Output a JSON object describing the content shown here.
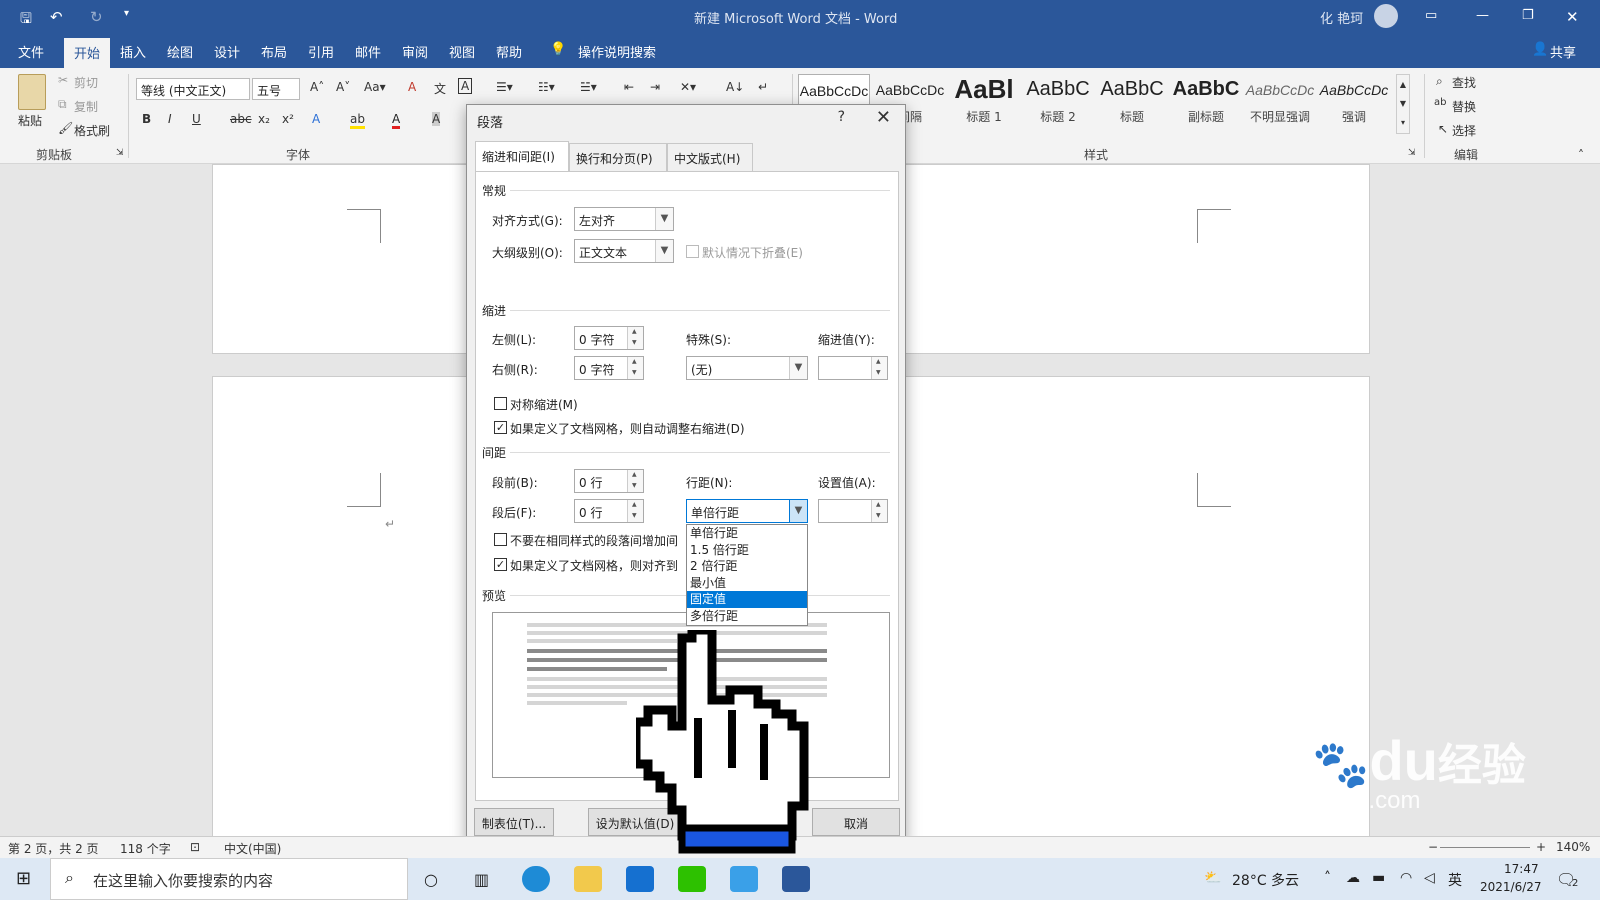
{
  "titlebar": {
    "title": "新建 Microsoft Word 文档  -  Word",
    "user": "化 艳珂"
  },
  "menu": {
    "tabs": [
      "文件",
      "开始",
      "插入",
      "绘图",
      "设计",
      "布局",
      "引用",
      "邮件",
      "审阅",
      "视图",
      "帮助"
    ],
    "active": "开始",
    "tell_me": "操作说明搜索",
    "share": "共享"
  },
  "ribbon": {
    "clipboard": {
      "paste": "粘贴",
      "cut": "剪切",
      "copy": "复制",
      "format_painter": "格式刷",
      "label": "剪贴板"
    },
    "font": {
      "font_name": "等线 (中文正文)",
      "font_size": "五号",
      "label": "字体"
    },
    "styles": {
      "items": [
        {
          "sample": "AaBbCcDc",
          "name": ""
        },
        {
          "sample": "AaBbCcDc",
          "name": "间隔"
        },
        {
          "sample": "AaBl",
          "name": "标题 1"
        },
        {
          "sample": "AaBbC",
          "name": "标题 2"
        },
        {
          "sample": "AaBbC",
          "name": "标题"
        },
        {
          "sample": "AaBbC",
          "name": "副标题"
        },
        {
          "sample": "AaBbCcDc",
          "name": "不明显强调"
        },
        {
          "sample": "AaBbCcDc",
          "name": "强调"
        }
      ],
      "label": "样式"
    },
    "editing": {
      "find": "查找",
      "replace": "替换",
      "select": "选择",
      "label": "编辑"
    }
  },
  "dialog": {
    "title": "段落",
    "help": "?",
    "tabs": [
      "缩进和间距(I)",
      "换行和分页(P)",
      "中文版式(H)"
    ],
    "general": {
      "heading": "常规",
      "alignment_label": "对齐方式(G):",
      "alignment_value": "左对齐",
      "outline_label": "大纲级别(O):",
      "outline_value": "正文文本",
      "collapse_label": "默认情况下折叠(E)"
    },
    "indent": {
      "heading": "缩进",
      "left_label": "左侧(L):",
      "left_value": "0 字符",
      "right_label": "右侧(R):",
      "right_value": "0 字符",
      "special_label": "特殊(S):",
      "special_value": "(无)",
      "indent_by_label": "缩进值(Y):",
      "mirror_label": "对称缩进(M)",
      "grid_label": "如果定义了文档网格，则自动调整右缩进(D)"
    },
    "spacing": {
      "heading": "间距",
      "before_label": "段前(B):",
      "before_value": "0 行",
      "after_label": "段后(F):",
      "after_value": "0 行",
      "line_label": "行距(N):",
      "line_value": "单倍行距",
      "at_label": "设置值(A):",
      "no_space_label": "不要在相同样式的段落间增加间",
      "snap_label": "如果定义了文档网格，则对齐到"
    },
    "line_options": [
      "单倍行距",
      "1.5 倍行距",
      "2 倍行距",
      "最小值",
      "固定值",
      "多倍行距"
    ],
    "line_highlight": "固定值",
    "preview_heading": "预览",
    "buttons": {
      "tabs": "制表位(T)...",
      "default": "设为默认值(D)",
      "cancel": "取消"
    }
  },
  "status": {
    "page": "第 2 页，共 2 页",
    "words": "118 个字",
    "lang": "中文(中国)",
    "zoom": "140%"
  },
  "taskbar": {
    "search_placeholder": "在这里输入你要搜索的内容",
    "weather": "28°C 多云",
    "ime": "英",
    "time": "17:47",
    "date": "2021/6/27",
    "notifications": "2"
  },
  "watermark": {
    "brand": "Bai",
    "brand2": "du",
    "cn": "经验",
    "url": "jingyan.baidu.com"
  },
  "colors": {
    "accent": "#2b579a",
    "selection": "#0078d7",
    "cursor_blue": "#1a56e0"
  }
}
